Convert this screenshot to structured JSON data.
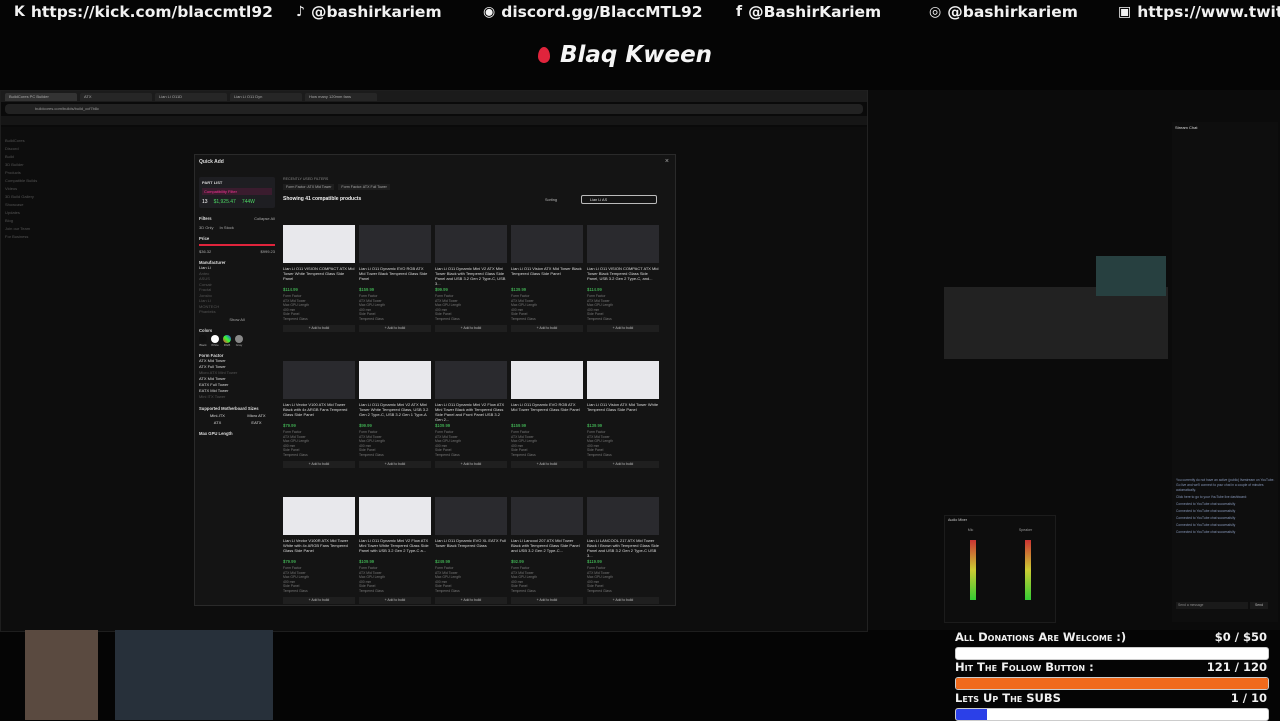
{
  "socials": [
    {
      "icon": "kick-icon",
      "glyph": "K",
      "text": "https://kick.com/blaccmtl92"
    },
    {
      "icon": "tiktok-icon",
      "glyph": "♪",
      "text": "@bashirkariem"
    },
    {
      "icon": "discord-icon",
      "glyph": "◉",
      "text": "discord.gg/BlaccMTL92"
    },
    {
      "icon": "facebook-icon",
      "glyph": "f",
      "text": "@BashirKariem"
    },
    {
      "icon": "instagram-icon",
      "glyph": "◎",
      "text": "@bashirkariem"
    },
    {
      "icon": "twitch-icon",
      "glyph": "▣",
      "text": "https://www.twitc"
    }
  ],
  "brand": {
    "text": "Blaq Kween",
    "accent": "#e0243c"
  },
  "browser": {
    "tabs": [
      "BuildCores PC Builder",
      "ATX",
      "Lian Li O11D",
      "Lian Li O11 Dyn",
      "How many 120mm fans"
    ],
    "address": "buildcores.com/builds/build_ccf7b8c",
    "leftnav": [
      "BuildCores",
      "Discord",
      "Build",
      "3D Builder",
      "Products",
      "Compatible Builds",
      "Videos",
      "3D Build Gallery",
      "Showcase",
      "Updates",
      "Blog",
      "Join our Team",
      "For Business"
    ]
  },
  "modal": {
    "title": "Quick Add",
    "close": "×",
    "part_list": "PART LIST",
    "compatibility_filter": "Compatibility Filter",
    "parts_count": "13",
    "total_price": "$1,925.47",
    "wattage": "744W",
    "recently_filtered": "RECENTLY USED FILTERS",
    "chips": [
      "Form Factor: ATX Mid Tower",
      "Form Factor: ATX Full Tower"
    ],
    "showing": "Showing 41 compatible products",
    "sorting": "Sorting",
    "search_value": "Lian Li AS",
    "filters": "Filters",
    "collapse_all": "Collapse All",
    "three_d_only": "3D Only",
    "in_stock": "In Stock",
    "price_label": "Price",
    "price_min": "$36.32",
    "price_max": "$999.23",
    "manufacturer_label": "Manufacturer",
    "manufacturers": [
      "Lian Li",
      "Antec",
      "ASUS",
      "Corsair",
      "Fractal",
      "Jonsbo",
      "Lian Li",
      "MONTECH",
      "Phanteks"
    ],
    "show_all": "Show All",
    "colors_label": "Colors",
    "colors": [
      "Black",
      "White",
      "RGB",
      "Gray"
    ],
    "form_factor_label": "Form Factor",
    "form_factors": [
      "ATX Mid Tower",
      "ATX Full Tower",
      "Micro ATX Mini Tower",
      "ATX Mid Tower",
      "EATX Full Tower",
      "EATX Mid Tower",
      "Mini ITX Tower"
    ],
    "motherboard_label": "Supported Motherboard Sizes",
    "motherboards": [
      "Mini-ITX",
      "Micro ATX",
      "ATX",
      "EATX"
    ],
    "gpu_label": "Max GPU Length",
    "add_to_build": "+ Add to build",
    "products": [
      {
        "name": "Lian Li O11 VISION COMPACT ATX Mid Tower White Tempered Glass Side Panel",
        "price": "$114.99",
        "img": "white"
      },
      {
        "name": "Lian Li O11 Dynamic EVO RGB ATX Mid Tower Black Tempered Glass Side Panel",
        "price": "$159.99",
        "img": "dark"
      },
      {
        "name": "Lian Li O11 Dynamic Mini V2 ATX Mini Tower Black with Tempered Glass Side Panel and USB 3.2 Gen 2 Type-C, USB 3...",
        "price": "$99.99",
        "img": "dark"
      },
      {
        "name": "Lian Li O11 Vision ATX Mid Tower Black Tempered Glass Side Panel",
        "price": "$139.99",
        "img": "dark"
      },
      {
        "name": "Lian Li O11 VISION COMPACT ATX Mid Tower Black Tempered Glass Side Panel, USB 3.2 Gen 2 Type-C, and...",
        "price": "$114.99",
        "img": "dark"
      },
      {
        "name": "Lian Li Vector V100 ATX Mid Tower Black with 4x ARGB Fans Tempered Glass Side Panel",
        "price": "$79.99",
        "img": "dark"
      },
      {
        "name": "Lian Li O11 Dynamic Mini V2 ATX Mini Tower White Tempered Glass, USB 3.2 Gen 2 Type-C, USB 3.2 Gen 1 Type-A",
        "price": "$99.99",
        "img": "white"
      },
      {
        "name": "Lian Li O11 Dynamic Mini V2 Flow ATX Mini Tower Black with Tempered Glass Side Panel and Front Panel USB 3.2 Gen 2...",
        "price": "$109.99",
        "img": "dark"
      },
      {
        "name": "Lian Li O11 Dynamic EVO RGB ATX Mid Tower Tempered Glass Side Panel",
        "price": "$159.99",
        "img": "white"
      },
      {
        "name": "Lian Li O11 Vision ATX Mid Tower White Tempered Glass Side Panel",
        "price": "$139.99",
        "img": "white"
      },
      {
        "name": "Lian Li Vector V100R ATX Mid Tower White with 4x ARGB Fans Tempered Glass Side Panel",
        "price": "$79.99",
        "img": "white"
      },
      {
        "name": "Lian Li O11 Dynamic Mini V2 Flow ATX Mini Tower White Tempered Glass Side Panel with USB 3.2 Gen 2 Type-C a...",
        "price": "$109.99",
        "img": "white"
      },
      {
        "name": "Lian Li O11 Dynamic EVO XL EATX Full Tower Black Tempered Glass",
        "price": "$249.99",
        "img": "dark"
      },
      {
        "name": "Lian Li Lancool 207 ATX Mid Tower Black with Tempered Glass Side Panel and USB 3.2 Gen 2 Type-C...",
        "price": "$92.99",
        "img": "dark"
      },
      {
        "name": "Lian Li LANCOOL 217 ATX Mid Tower Black / Brown with Tempered Glass Side Panel and USB 3.2 Gen 2 Type-C USB 3...",
        "price": "$119.99",
        "img": "dark"
      }
    ],
    "spec_lines": [
      "Form Factor",
      "ATX Mid Tower",
      "Max GPU Length",
      "400 mm",
      "Side Panel",
      "Tempered Glass"
    ]
  },
  "obs": {
    "chat_title": "Stream Chat",
    "chat_lines": [
      "You currently do not have an active (public) livestream on YouTube. Go live and we'll connect to your chat in a couple of minutes automatically.",
      "Click here to go to your YouTube live dashboard:",
      "Connected to YouTube chat successfully",
      "Connected to YouTube chat successfully",
      "Connected to YouTube chat successfully",
      "Connected to YouTube chat successfully",
      "Connected to YouTube chat successfully"
    ],
    "chat_placeholder": "Send a message",
    "send": "Send",
    "mixer_title": "Audio Mixer",
    "mixer_channels": [
      "Mic",
      "Speaker"
    ]
  },
  "goals": [
    {
      "label": "All Donations Are Welcome :)",
      "count": "$0 / $50",
      "progress": 0.0,
      "color": "#3b6cf0"
    },
    {
      "label": "Hit The Follow Button :",
      "count": "121 / 120",
      "progress": 1.0,
      "color": "#f06a1c"
    },
    {
      "label": "Lets Up The SUBS",
      "count": "1 / 10",
      "progress": 0.1,
      "color": "#2b40e8"
    }
  ]
}
